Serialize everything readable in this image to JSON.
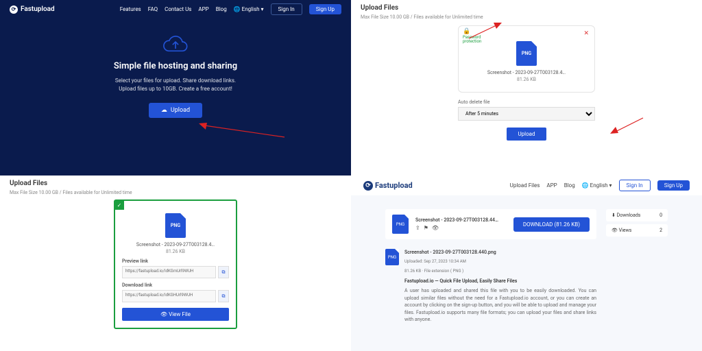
{
  "brand": "Fastupload",
  "q1": {
    "nav": [
      "Features",
      "FAQ",
      "Contact Us",
      "APP",
      "Blog"
    ],
    "lang": "English",
    "signin": "Sign In",
    "signup": "Sign Up",
    "title": "Simple file hosting and sharing",
    "sub1": "Select your files for upload. Share download links.",
    "sub2": "Upload files up to 10GB. Create a free account!",
    "upload": "Upload"
  },
  "q2": {
    "title": "Upload Files",
    "meta": "Max File Size 10.00 GB / Files available for Unlimited time",
    "pw1": "Password",
    "pw2": "protection",
    "ext": "PNG",
    "fname": "Screenshot - 2023-09-27T003128.4…",
    "fsize": "81.26 KB",
    "autodel": "Auto delete file",
    "sel": "After 5 minutes",
    "upload": "Upload"
  },
  "q3": {
    "title": "Upload Files",
    "meta": "Max File Size 10.00 GB / Files available for Unlimited time",
    "ext": "PNG",
    "fname": "Screenshot - 2023-09-27T003128.4…",
    "fsize": "81.26 KB",
    "preview_lbl": "Preview link",
    "preview_val": "https://fastupload.io/IdKGmUrl9WUH",
    "download_lbl": "Download link",
    "download_val": "https://fastupload.io/IdKGHUrl9WUH",
    "view": "View File"
  },
  "q4": {
    "nav": [
      "Upload Files",
      "APP",
      "Blog"
    ],
    "lang": "English",
    "signin": "Sign In",
    "signup": "Sign Up",
    "ext": "PNG",
    "fname": "Screenshot - 2023-09-27T003128.44…",
    "dl": "DOWNLOAD (81.26 KB)",
    "fname2": "Screenshot - 2023-09-27T003128.440.png",
    "uploaded": "Uploaded: Sep 27, 2023 10:34 AM",
    "size_ext": "81.26 KB · File extension ( PNG )",
    "tagline": "Fastupload.io — Quick File Upload, Easily Share Files",
    "desc": "A user has uploaded and shared this file with you to be easily downloaded. You can upload similar files without the need for a Fastupload.io account, or you can create an account by clicking on the sign-up button, and you will be able to upload and manage your files. Fastupload.io supports many file formats; you can upload your files and share links with anyone.",
    "downloads_lbl": "Downloads",
    "downloads_val": "0",
    "views_lbl": "Views",
    "views_val": "2"
  }
}
